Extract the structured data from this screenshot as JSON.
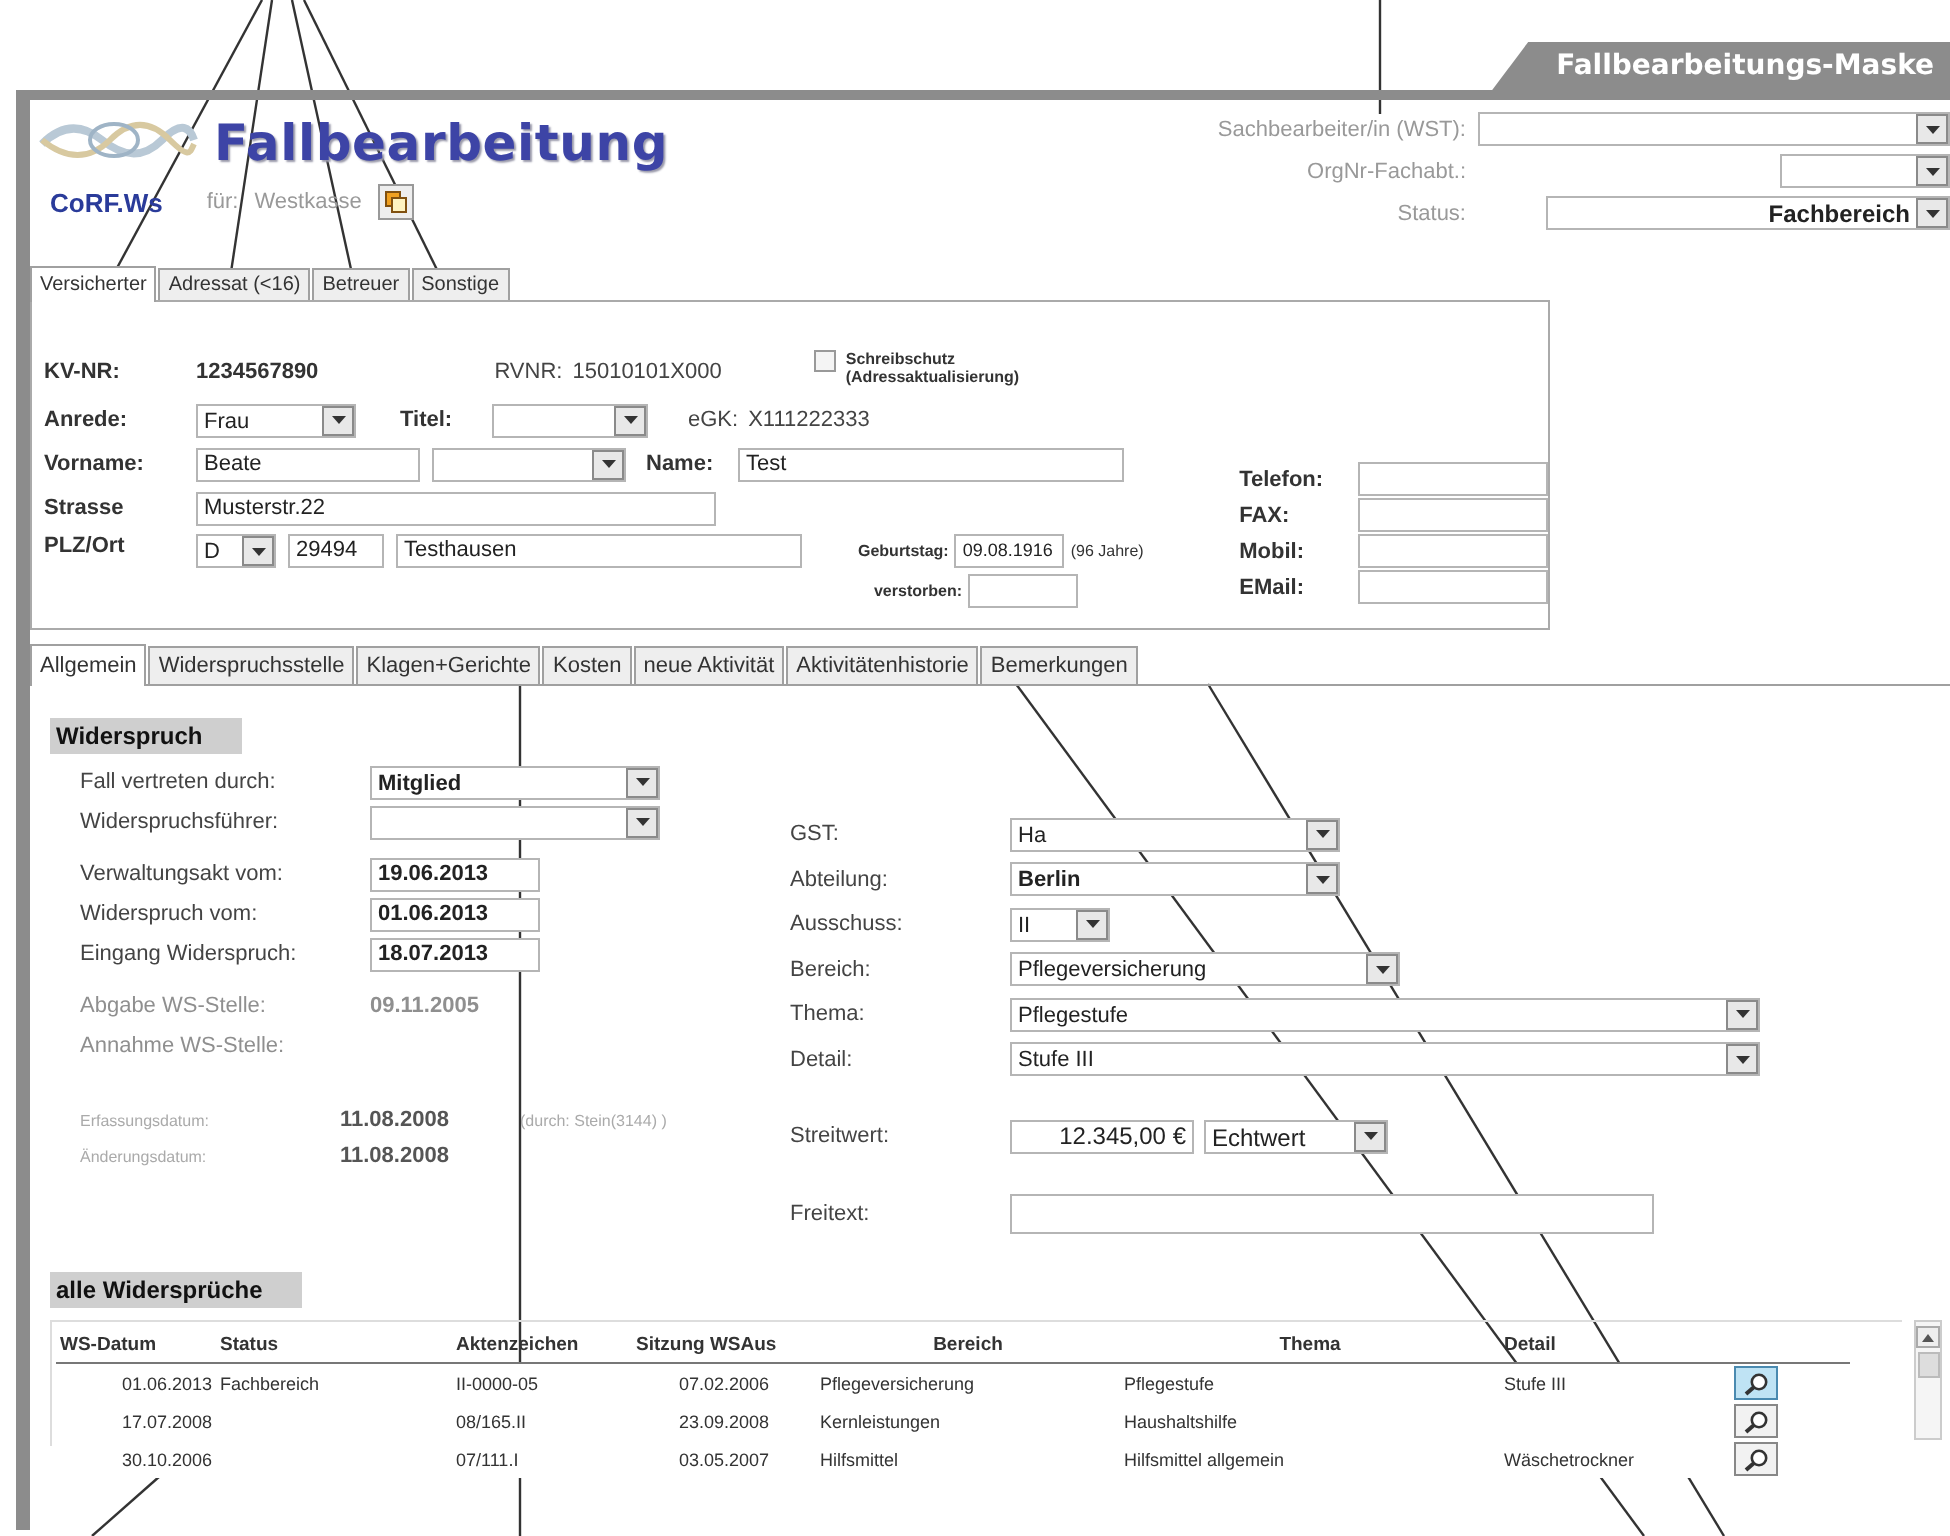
{
  "banner": {
    "title": "Fallbearbeitungs-Maske"
  },
  "header": {
    "title": "Fallbearbeitung",
    "product": "CoRF.Ws",
    "for_label": "für:",
    "for_value": "Westkasse"
  },
  "assignment": [
    {
      "label": "Sachbearbeiter/in (WST):"
    },
    {
      "label": "OrgNr-Fachabt.:"
    },
    {
      "label": "Status:",
      "value": "Fachbereich"
    }
  ],
  "person_tabs": [
    {
      "label": "Versicherter",
      "selected": true
    },
    {
      "label": "Adressat (<16)",
      "selected": false
    },
    {
      "label": "Betreuer",
      "selected": false
    },
    {
      "label": "Sonstige",
      "selected": false
    }
  ],
  "person": {
    "kv_nr": {
      "label": "KV-NR:",
      "value": "1234567890"
    },
    "rvnr": {
      "label": "RVNR:",
      "value": "15010101X000"
    },
    "egk": {
      "label": "eGK:",
      "value": "X111222333"
    },
    "write_protect": {
      "label": "Schreibschutz",
      "note": "(Adressaktualisierung)",
      "checked": false
    },
    "anrede": {
      "label": "Anrede:",
      "value": "Frau"
    },
    "titel": {
      "label": "Titel:"
    },
    "vorname": {
      "label": "Vorname:",
      "value": "Beate"
    },
    "name": {
      "label": "Name:",
      "value": "Test"
    },
    "strasse": {
      "label": "Strasse",
      "value": "Musterstr.22"
    },
    "plz_ort": {
      "label": "PLZ/Ort",
      "country": "D",
      "plz": "29494",
      "ort": "Testhausen"
    },
    "geburtstag": {
      "label": "Geburtstag:",
      "value": "09.08.1916",
      "age": "(96 Jahre)"
    },
    "verstorben": {
      "label": "verstorben:"
    },
    "contacts": [
      {
        "label": "Telefon:"
      },
      {
        "label": "FAX:"
      },
      {
        "label": "Mobil:"
      },
      {
        "label": "EMail:"
      }
    ]
  },
  "case_tabs": [
    {
      "label": "Allgemein",
      "selected": true
    },
    {
      "label": "Widerspruchsstelle",
      "selected": false
    },
    {
      "label": "Klagen+Gerichte",
      "selected": false
    },
    {
      "label": "Kosten",
      "selected": false
    },
    {
      "label": "neue Aktivität",
      "selected": false
    },
    {
      "label": "Aktivitätenhistorie",
      "selected": false
    },
    {
      "label": "Bemerkungen",
      "selected": false
    }
  ],
  "widerspruch": {
    "title": "Widerspruch",
    "left": [
      {
        "label": "Fall vertreten durch:",
        "kind": "combo",
        "value": "Mitglied",
        "disabled": false
      },
      {
        "label": "Widerspruchsführer:",
        "kind": "combo",
        "disabled": false
      },
      {
        "label": "Verwaltungsakt vom:",
        "kind": "date",
        "value": "19.06.2013",
        "disabled": false
      },
      {
        "label": "Widerspruch vom:",
        "kind": "date",
        "value": "01.06.2013",
        "disabled": false
      },
      {
        "label": "Eingang Widerspruch:",
        "kind": "date",
        "value": "18.07.2013",
        "disabled": false
      },
      {
        "label": "Abgabe WS-Stelle:",
        "kind": "text",
        "value": "09.11.2005",
        "disabled": true
      },
      {
        "label": "Annahme WS-Stelle:",
        "kind": "text",
        "disabled": true
      }
    ],
    "audit": [
      {
        "label": "Erfassungsdatum:",
        "value": "11.08.2008",
        "by": "(durch: Stein(3144) )"
      },
      {
        "label": "Änderungsdatum:",
        "value": "11.08.2008"
      }
    ],
    "right": [
      {
        "label": "GST:",
        "kind": "combo",
        "value": "Ha"
      },
      {
        "label": "Abteilung:",
        "kind": "combo",
        "value": "Berlin"
      },
      {
        "label": "Ausschuss:",
        "kind": "combo",
        "value": "II"
      },
      {
        "label": "Bereich:",
        "kind": "combo",
        "value": "Pflegeversicherung"
      },
      {
        "label": "Thema:",
        "kind": "combo",
        "value": "Pflegestufe"
      },
      {
        "label": "Detail:",
        "kind": "combo",
        "value": "Stufe III"
      },
      {
        "label": "Streitwert:",
        "kind": "amount",
        "value": "12.345,00 €",
        "unit": "Echtwert"
      },
      {
        "label": "Freitext:",
        "kind": "field"
      }
    ]
  },
  "table": {
    "title": "alle Widersprüche",
    "columns": [
      "WS-Datum",
      "Status",
      "Aktenzeichen",
      "Sitzung WSAus",
      "Bereich",
      "Thema",
      "Detail"
    ],
    "rows": [
      {
        "cells": [
          "01.06.2013",
          "Fachbereich",
          "II-0000-05",
          "07.02.2006",
          "Pflegeversicherung",
          "Pflegestufe",
          "Stufe III"
        ],
        "selected": true
      },
      {
        "cells": [
          "17.07.2008",
          null,
          "08/165.II",
          "23.09.2008",
          "Kernleistungen",
          "Haushaltshilfe",
          null
        ],
        "selected": false
      },
      {
        "cells": [
          "30.10.2006",
          null,
          "07/111.I",
          "03.05.2007",
          "Hilfsmittel",
          "Hilfsmittel allgemein",
          "Wäschetrockner"
        ],
        "selected": false
      }
    ]
  }
}
